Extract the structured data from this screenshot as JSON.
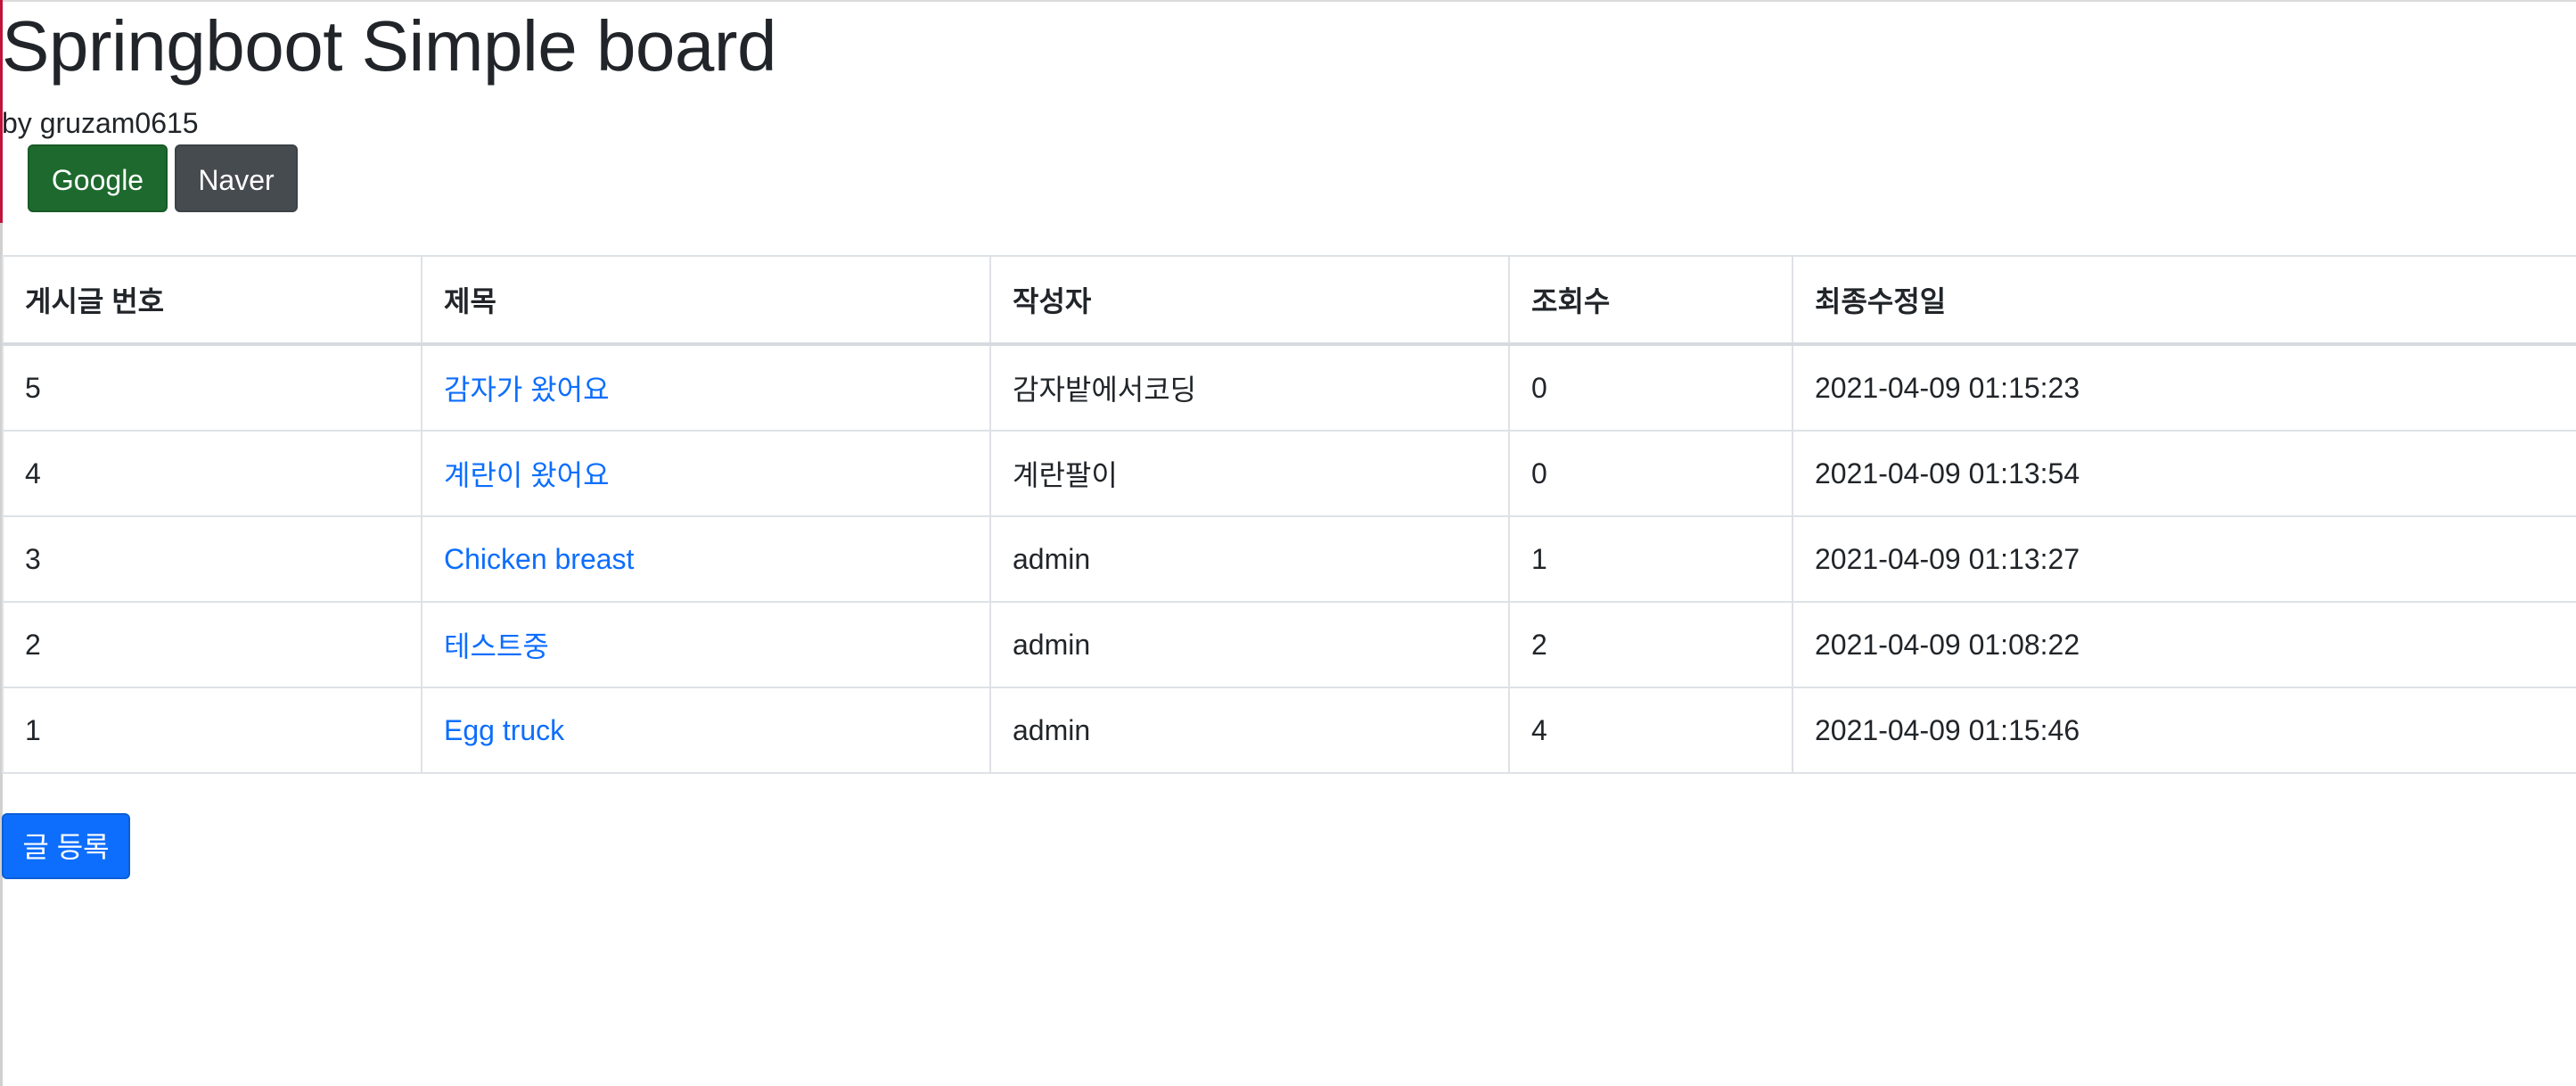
{
  "page": {
    "title": "Springboot Simple board",
    "author_line": "by gruzam0615"
  },
  "social_buttons": {
    "google": "Google",
    "naver": "Naver"
  },
  "table": {
    "headers": [
      "게시글 번호",
      "제목",
      "작성자",
      "조회수",
      "최종수정일"
    ],
    "rows": [
      {
        "no": "5",
        "title": "감자가 왔어요",
        "author": "감자밭에서코딩",
        "views": "0",
        "modified": "2021-04-09 01:15:23"
      },
      {
        "no": "4",
        "title": "계란이 왔어요",
        "author": "계란팔이",
        "views": "0",
        "modified": "2021-04-09 01:13:54"
      },
      {
        "no": "3",
        "title": "Chicken breast",
        "author": "admin",
        "views": "1",
        "modified": "2021-04-09 01:13:27"
      },
      {
        "no": "2",
        "title": "테스트중",
        "author": "admin",
        "views": "2",
        "modified": "2021-04-09 01:08:22"
      },
      {
        "no": "1",
        "title": "Egg truck",
        "author": "admin",
        "views": "4",
        "modified": "2021-04-09 01:15:46"
      }
    ]
  },
  "actions": {
    "write_label": "글 등록"
  },
  "colors": {
    "google_button": "#1e6a2e",
    "naver_button": "#464b50",
    "write_button": "#0d6efd",
    "link": "#0d6efd"
  }
}
